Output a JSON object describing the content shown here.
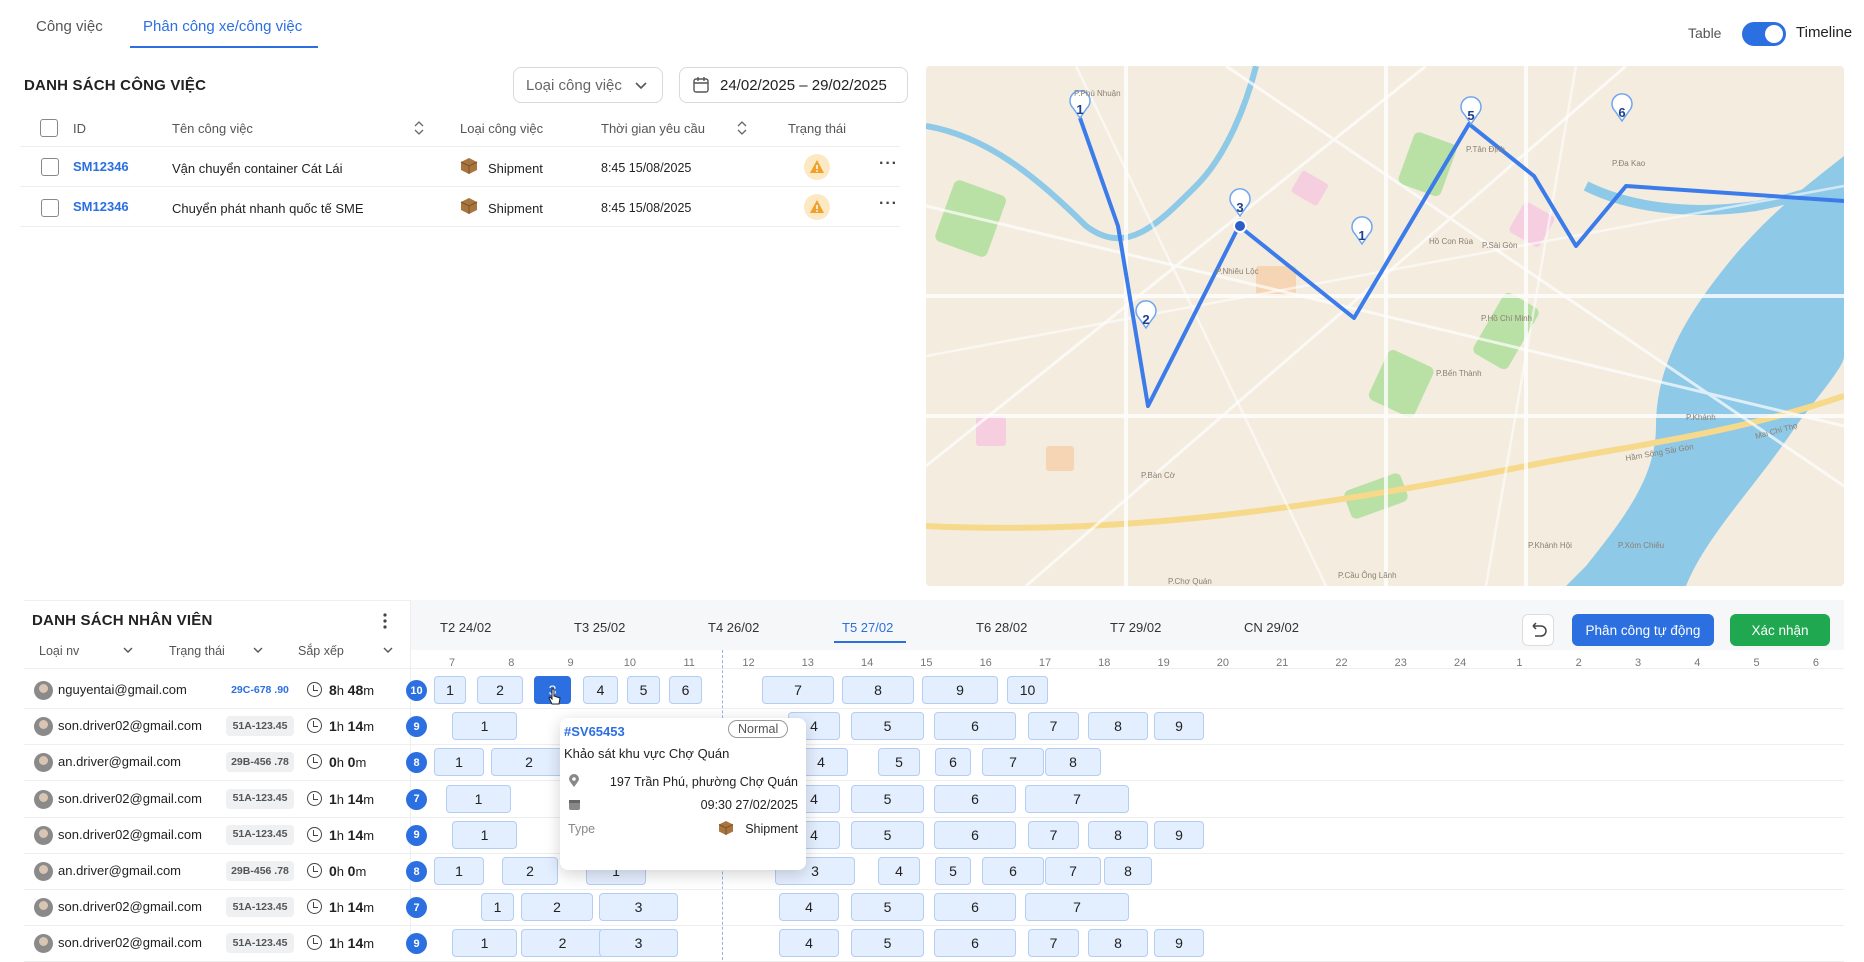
{
  "tabs": [
    {
      "label": "Công việc"
    },
    {
      "label": "Phân công xe/công việc"
    }
  ],
  "view_toggle": {
    "table_label": "Table",
    "timeline_label": "Timeline"
  },
  "jobs": {
    "title": "DANH SÁCH CÔNG VIỆC",
    "filter_label": "Loại công việc",
    "date_range": "24/02/2025 – 29/02/2025",
    "headers": {
      "id": "ID",
      "name": "Tên công việc",
      "type": "Loại công việc",
      "time": "Thời gian yêu cầu",
      "status": "Trạng thái"
    },
    "rows": [
      {
        "id": "SM12346",
        "name": "Vận chuyển container Cát Lái",
        "type": "Shipment",
        "time": "8:45 15/08/2025"
      },
      {
        "id": "SM12346",
        "name": "Chuyển phát nhanh quốc tế SME",
        "type": "Shipment",
        "time": "8:45 15/08/2025"
      }
    ]
  },
  "map": {
    "markers": [
      "1",
      "5",
      "6",
      "3",
      "1",
      "2"
    ],
    "labels": [
      "P.Phú Nhuận",
      "P.Tân Định",
      "P.Đa Kao",
      "P.Nhiêu Lộc",
      "Hồ Con Rùa",
      "P.Sài Gòn",
      "P.Hồ Chí Minh",
      "P.Bến Thành",
      "P.Bàn Cờ",
      "P.Chợ Quán",
      "P.Cầu Ông Lãnh",
      "P.Khánh Hội",
      "P.Xóm Chiếu",
      "P.Khánh",
      "Hầm Sông Sài Gòn",
      "Mai Chí Thọ"
    ],
    "colors": {
      "route": "#3b7bea",
      "water": "#8fc9e8",
      "park": "#b9e0a5"
    }
  },
  "staff": {
    "title": "DANH SÁCH NHÂN VIÊN",
    "filters": {
      "type": "Loại nv",
      "status": "Trạng thái",
      "sort": "Sắp xếp"
    },
    "rows": [
      {
        "email": "nguyentai@gmail.com",
        "plate": "29C-678 .90",
        "h": "8",
        "m": "48",
        "count": "10",
        "tasks": [
          "1",
          "2",
          "3",
          "4",
          "5",
          "6",
          "7",
          "8",
          "9",
          "10"
        ]
      },
      {
        "email": "son.driver02@gmail.com",
        "plate": "51A-123.45",
        "h": "1",
        "m": "14",
        "count": "9",
        "tasks": [
          "1",
          "4",
          "5",
          "6",
          "7",
          "8",
          "9"
        ]
      },
      {
        "email": "an.driver@gmail.com",
        "plate": "29B-456 .78",
        "h": "0",
        "m": "0",
        "count": "8",
        "tasks": [
          "1",
          "2",
          "3",
          "4",
          "5",
          "6",
          "7",
          "8"
        ]
      },
      {
        "email": "son.driver02@gmail.com",
        "plate": "51A-123.45",
        "h": "1",
        "m": "14",
        "count": "7",
        "tasks": [
          "1",
          "4",
          "5",
          "6",
          "7"
        ]
      },
      {
        "email": "son.driver02@gmail.com",
        "plate": "51A-123.45",
        "h": "1",
        "m": "14",
        "count": "9",
        "tasks": [
          "1",
          "4",
          "5",
          "6",
          "7",
          "8",
          "9"
        ]
      },
      {
        "email": "an.driver@gmail.com",
        "plate": "29B-456 .78",
        "h": "0",
        "m": "0",
        "count": "8",
        "tasks": [
          "1",
          "2",
          "1",
          "3",
          "4",
          "5",
          "6",
          "7",
          "8"
        ]
      },
      {
        "email": "son.driver02@gmail.com",
        "plate": "51A-123.45",
        "h": "1",
        "m": "14",
        "count": "7",
        "tasks": [
          "1",
          "2",
          "3",
          "4",
          "5",
          "6",
          "7"
        ]
      },
      {
        "email": "son.driver02@gmail.com",
        "plate": "51A-123.45",
        "h": "1",
        "m": "14",
        "count": "9",
        "tasks": [
          "1",
          "2",
          "3",
          "4",
          "5",
          "6",
          "7",
          "8",
          "9"
        ]
      }
    ],
    "units": {
      "h": "h",
      "m": "m"
    }
  },
  "timeline": {
    "days": [
      {
        "dow": "T2",
        "date": "24/02"
      },
      {
        "dow": "T3",
        "date": "25/02"
      },
      {
        "dow": "T4",
        "date": "26/02"
      },
      {
        "dow": "T5",
        "date": "27/02"
      },
      {
        "dow": "T6",
        "date": "28/02"
      },
      {
        "dow": "T7",
        "date": "29/02"
      },
      {
        "dow": "CN",
        "date": "29/02"
      }
    ],
    "hours": [
      "7",
      "8",
      "9",
      "10",
      "11",
      "12",
      "13",
      "14",
      "15",
      "16",
      "17",
      "18",
      "19",
      "20",
      "21",
      "22",
      "23",
      "24",
      "1",
      "2",
      "3",
      "4",
      "5",
      "6"
    ],
    "auto_assign": "Phân công tự động",
    "confirm": "Xác nhận"
  },
  "tooltip": {
    "id": "#SV65453",
    "badge": "Normal",
    "title": "Khảo sát khu vực Chợ Quán",
    "address": "197 Trần Phú, phường Chợ Quán",
    "datetime": "09:30 27/02/2025",
    "type_label": "Type",
    "type_value": "Shipment"
  }
}
